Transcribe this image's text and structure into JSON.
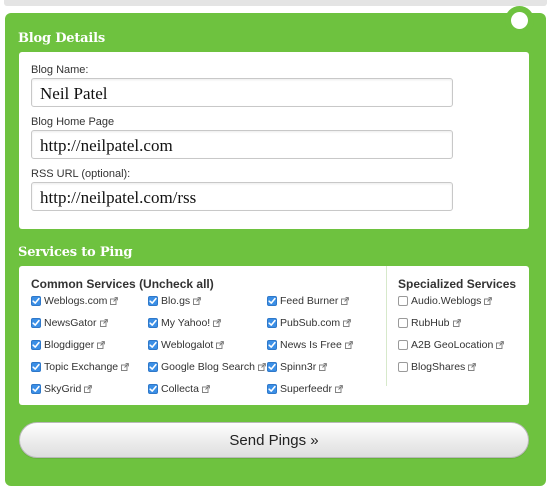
{
  "blog_details": {
    "title": "Blog Details",
    "fields": [
      {
        "label": "Blog Name:",
        "value": "Neil Patel"
      },
      {
        "label": "Blog Home Page",
        "value": "http://neilpatel.com"
      },
      {
        "label": "RSS URL (optional):",
        "value": "http://neilpatel.com/rss"
      }
    ]
  },
  "services": {
    "title": "Services to Ping",
    "common_heading": "Common Services",
    "uncheck_all": "(Uncheck all)",
    "specialized_heading": "Specialized Services",
    "common": [
      [
        {
          "label": "Weblogs.com",
          "checked": true
        },
        {
          "label": "NewsGator",
          "checked": true
        },
        {
          "label": "Blogdigger",
          "checked": true
        },
        {
          "label": "Topic Exchange",
          "checked": true
        },
        {
          "label": "SkyGrid",
          "checked": true
        }
      ],
      [
        {
          "label": "Blo.gs",
          "checked": true
        },
        {
          "label": "My Yahoo!",
          "checked": true
        },
        {
          "label": "Weblogalot",
          "checked": true
        },
        {
          "label": "Google Blog Search",
          "checked": true
        },
        {
          "label": "Collecta",
          "checked": true
        }
      ],
      [
        {
          "label": "Feed Burner",
          "checked": true
        },
        {
          "label": "PubSub.com",
          "checked": true
        },
        {
          "label": "News Is Free",
          "checked": true
        },
        {
          "label": "Spinn3r",
          "checked": true
        },
        {
          "label": "Superfeedr",
          "checked": true
        }
      ]
    ],
    "specialized": [
      {
        "label": "Audio.Weblogs",
        "checked": false
      },
      {
        "label": "RubHub",
        "checked": false
      },
      {
        "label": "A2B GeoLocation",
        "checked": false
      },
      {
        "label": "BlogShares",
        "checked": false
      }
    ]
  },
  "send_button": {
    "label": "Send Pings »"
  },
  "colors": {
    "panel_green": "#6ec23f",
    "checkbox_blue": "#3b8fe6"
  },
  "icons": {
    "external_link": "external-link-icon",
    "check": "checkmark-icon"
  }
}
